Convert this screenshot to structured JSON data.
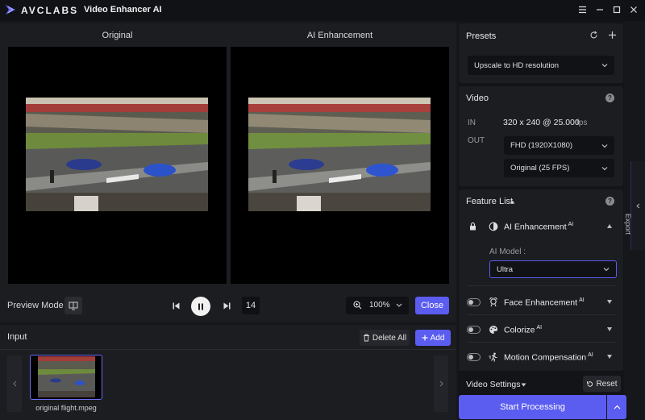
{
  "titlebar": {
    "brand": "AVCLABS",
    "app_title": "Video Enhancer AI"
  },
  "preview": {
    "original_label": "Original",
    "enhanced_label": "AI Enhancement",
    "preview_mode_label": "Preview Mode",
    "frame_number": "14",
    "zoom_level": "100%",
    "close_label": "Close"
  },
  "input": {
    "title": "Input",
    "delete_all_label": "Delete All",
    "add_label": "Add",
    "files": [
      {
        "name": "original flight.mpeg"
      }
    ]
  },
  "presets": {
    "title": "Presets",
    "selected": "Upscale to HD resolution"
  },
  "video": {
    "title": "Video",
    "in_label": "IN",
    "in_value": "320 x 240 @ 25.000",
    "in_unit": "fps",
    "out_label": "OUT",
    "resolution": "FHD (1920X1080)",
    "frame_rate": "Original (25 FPS)"
  },
  "features": {
    "title": "Feature List",
    "ai_model_label": "AI Model :",
    "ai_model": "Ultra",
    "ai_badge": "AI",
    "items": [
      {
        "label": "AI Enhancement",
        "locked": true,
        "expanded": true
      },
      {
        "label": "Face Enhancement",
        "enabled": false
      },
      {
        "label": "Colorize",
        "enabled": false
      },
      {
        "label": "Motion Compensation",
        "enabled": false
      }
    ]
  },
  "video_settings": {
    "title": "Video Settings",
    "reset_label": "Reset"
  },
  "start_label": "Start Processing",
  "export_label": "Export",
  "colors": {
    "accent": "#5b5cf0",
    "panel": "#1c1d21",
    "background": "#16171b"
  }
}
